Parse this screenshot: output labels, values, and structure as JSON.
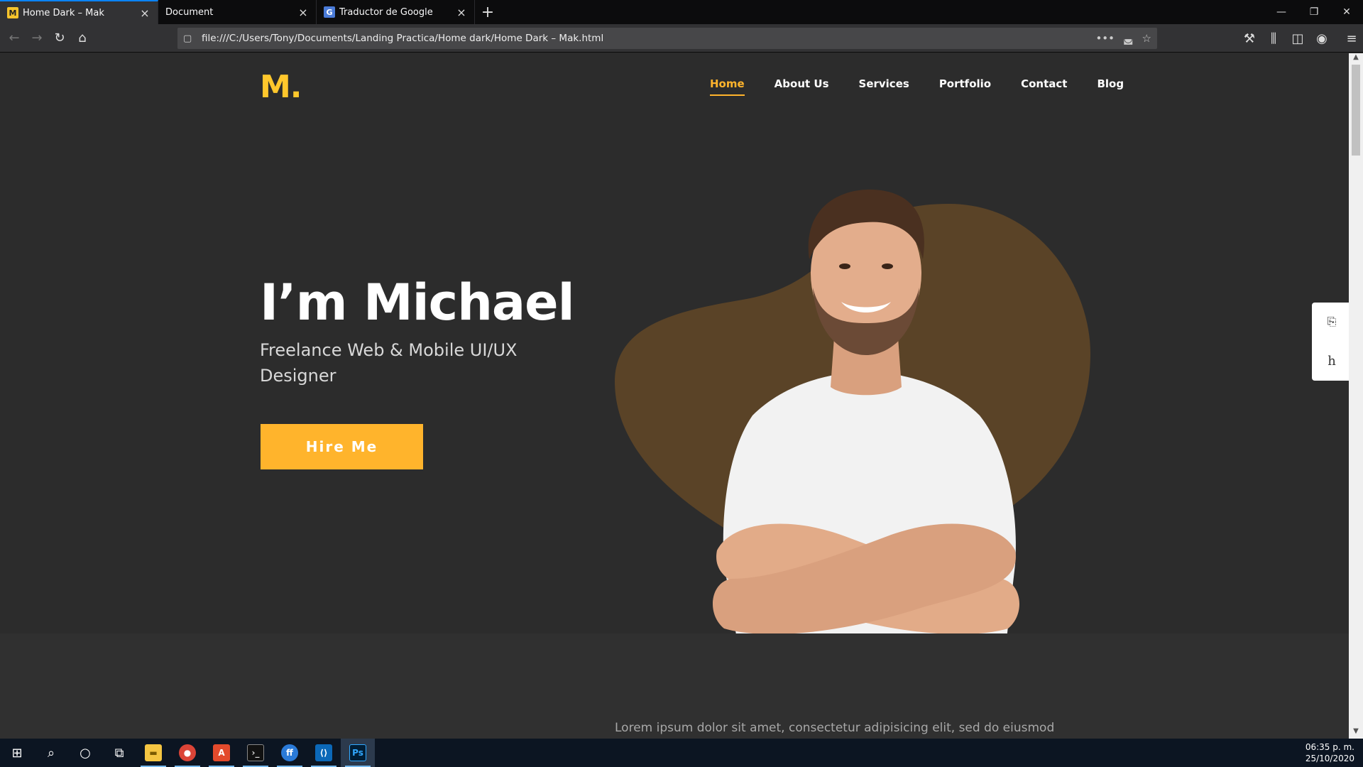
{
  "browser": {
    "tabs": [
      {
        "title": "Home Dark – Mak",
        "favicon": "M",
        "active": true
      },
      {
        "title": "Document",
        "favicon": "",
        "active": false
      },
      {
        "title": "Traductor de Google",
        "favicon": "G",
        "active": false
      }
    ],
    "url": "file:///C:/Users/Tony/Documents/Landing Practica/Home dark/Home Dark – Mak.html"
  },
  "site": {
    "logo": "M.",
    "nav": [
      "Home",
      "About Us",
      "Services",
      "Portfolio",
      "Contact",
      "Blog"
    ],
    "hero_title": "I’m Michael",
    "hero_subtitle": "Freelance Web & Mobile UI/UX Designer",
    "hire_button": "Hire Me",
    "lorem": "Lorem ipsum dolor sit amet, consectetur adipisicing elit, sed do eiusmod",
    "side_widget_letter": "h"
  },
  "colors": {
    "accent": "#ffb42c",
    "logo": "#ffc72c",
    "background": "#2c2c2c",
    "blob": "#5a4327"
  },
  "taskbar": {
    "time": "06:35 p. m.",
    "date": "25/10/2020"
  }
}
